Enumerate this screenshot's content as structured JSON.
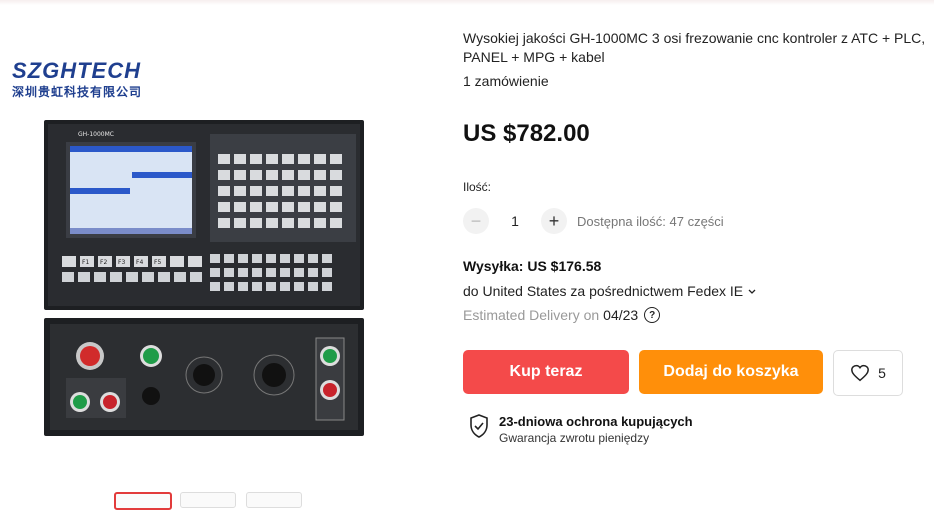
{
  "logo": {
    "en": "SZGHTECH",
    "cn": "深圳贵虹科技有限公司"
  },
  "product_image": {
    "model_label": "GH-1000MC",
    "f_keys": [
      "F1",
      "F2",
      "F3",
      "F4",
      "F5"
    ]
  },
  "product": {
    "title": "Wysokiej jakości GH-1000MC 3 osi frezowanie cnc kontroler z ATC + PLC, PANEL + MPG + kabel",
    "orders": "1 zamówienie",
    "price": "US $782.00"
  },
  "quantity": {
    "label": "Ilość:",
    "value": "1",
    "minus": "−",
    "plus": "+",
    "available": "Dostępna ilość: 47 części"
  },
  "shipping": {
    "cost": "Wysyłka: US $176.58",
    "destination": "do United States za pośrednictwem Fedex IE",
    "delivery_prefix": "Estimated Delivery on",
    "delivery_date": "04/23",
    "help_glyph": "?"
  },
  "actions": {
    "buy_now": "Kup teraz",
    "add_to_cart": "Dodaj do koszyka",
    "wishlist_count": "5"
  },
  "protection": {
    "title": "23-dniowa ochrona kupujących",
    "subtitle": "Gwarancja zwrotu pieniędzy"
  }
}
